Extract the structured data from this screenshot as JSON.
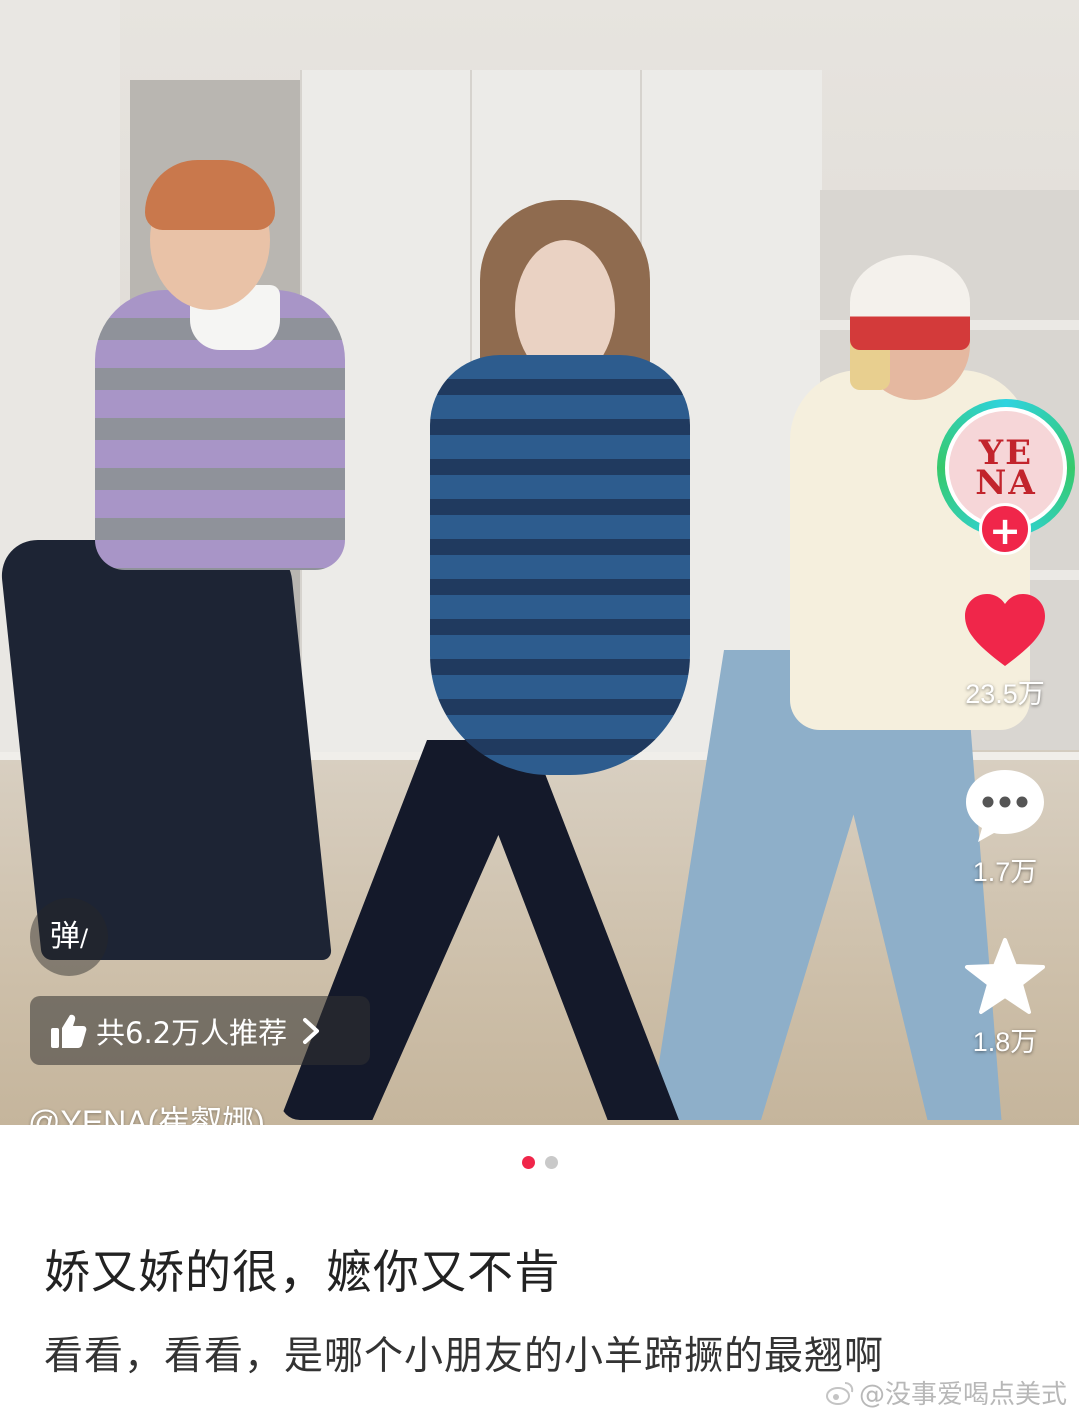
{
  "video": {
    "author": "@YENA(崔叡娜)",
    "avatar_text_line1": "YE",
    "avatar_text_line2": "NA",
    "follow_icon": "+",
    "likes": "23.5万",
    "comments": "1.7万",
    "favorites": "1.8万",
    "danmu_label": "弹",
    "recommend_text": "共6.2万人推荐",
    "colors": {
      "like": "#f0264a",
      "ring": "#2fd3e0",
      "accent": "#f0264a"
    }
  },
  "carousel": {
    "active_index": 0,
    "count": 2
  },
  "post": {
    "title": "娇又娇的很，嬷你又不肯",
    "body": "看看，看看，是哪个小朋友的小羊蹄撅的最翘啊"
  },
  "watermark": {
    "text": "@没事爱喝点美式",
    "icon": "weibo-icon"
  }
}
